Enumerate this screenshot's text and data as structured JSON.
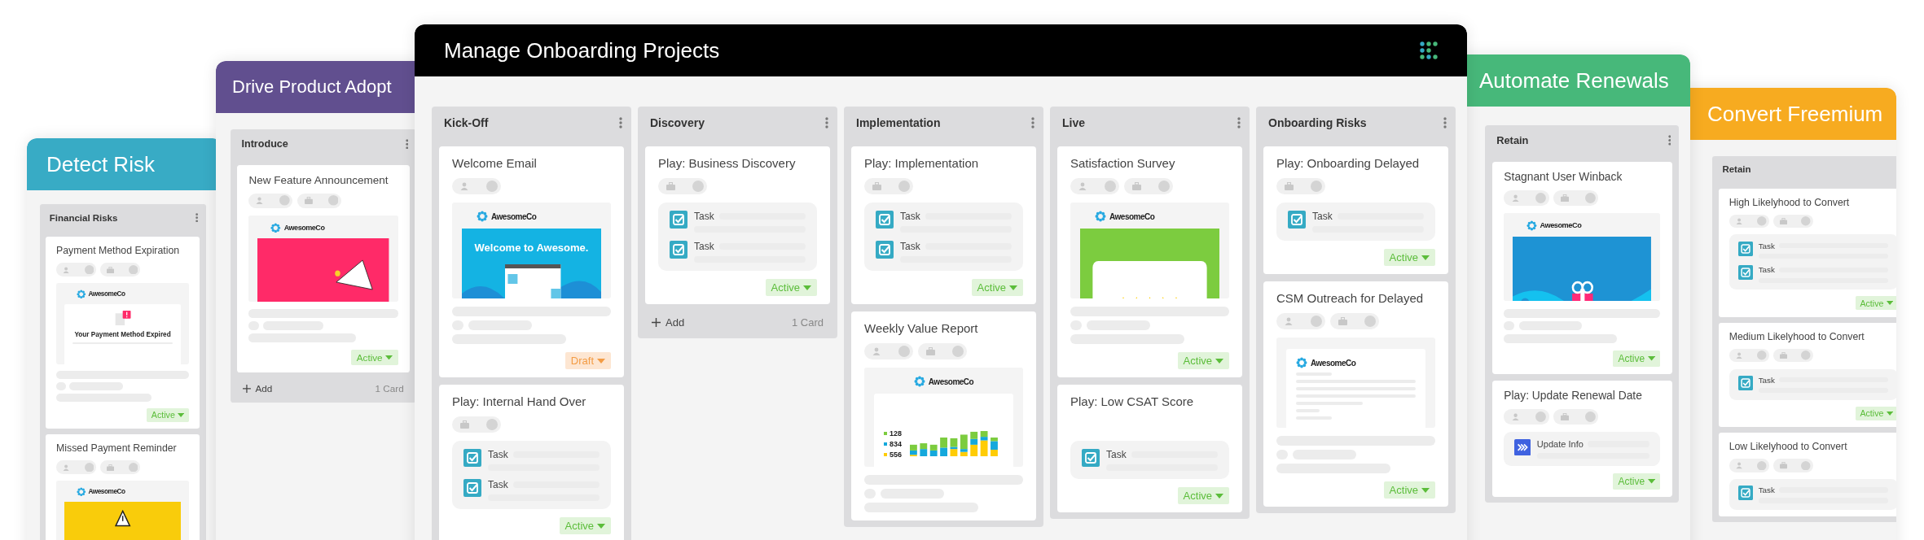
{
  "windows": [
    {
      "title": "Detect Risk",
      "color": "#38abc5",
      "columns": [
        {
          "title": "Financial Risks",
          "cards": [
            {
              "title": "Payment Method Expiration",
              "pills": [
                {
                  "kind": "person"
                },
                {
                  "kind": "briefcase"
                }
              ],
              "preview": {
                "kind": "expired",
                "logo": "AwesomeCo",
                "headline": "Your Payment Method Expired"
              },
              "placeholders": true,
              "status": {
                "label": "Active",
                "kind": "active"
              }
            },
            {
              "title": "Missed Payment Reminder",
              "pills": [
                {
                  "kind": "person"
                },
                {
                  "kind": "briefcase"
                }
              ],
              "preview": {
                "kind": "warning",
                "logo": "AwesomeCo"
              }
            }
          ]
        }
      ]
    },
    {
      "title": "Drive Product Adopt",
      "color": "#614f8f",
      "columns": [
        {
          "title": "Introduce",
          "cards": [
            {
              "title": "New Feature Announcement",
              "pills": [
                {
                  "kind": "person"
                },
                {
                  "kind": "briefcase"
                }
              ],
              "preview": {
                "kind": "megaphone",
                "logo": "AwesomeCo"
              },
              "placeholders": true,
              "status": {
                "label": "Active",
                "kind": "active"
              }
            }
          ],
          "footer": {
            "add": "Add",
            "count": "1 Card"
          }
        }
      ]
    },
    {
      "title": "Manage Onboarding Projects",
      "color": "#000000",
      "logo": true,
      "columns": [
        {
          "title": "Kick-Off",
          "cards": [
            {
              "title": "Welcome Email",
              "pills": [
                {
                  "kind": "person"
                }
              ],
              "preview": {
                "kind": "welcome",
                "logo": "AwesomeCo",
                "headline": "Welcome to Awesome."
              },
              "placeholders": true,
              "status": {
                "label": "Draft",
                "kind": "draft"
              }
            },
            {
              "title": "Play: Internal Hand Over",
              "pills": [
                {
                  "kind": "briefcase"
                }
              ],
              "tasks": [
                {
                  "label": "Task",
                  "kind": "task"
                },
                {
                  "label": "Task",
                  "kind": "task"
                }
              ],
              "status": {
                "label": "Active",
                "kind": "active"
              }
            }
          ]
        },
        {
          "title": "Discovery",
          "cards": [
            {
              "title": "Play: Business Discovery",
              "pills": [
                {
                  "kind": "briefcase"
                }
              ],
              "tasks": [
                {
                  "label": "Task",
                  "kind": "task"
                },
                {
                  "label": "Task",
                  "kind": "task"
                }
              ],
              "status": {
                "label": "Active",
                "kind": "active"
              }
            }
          ],
          "footer": {
            "add": "Add",
            "count": "1 Card"
          }
        },
        {
          "title": "Implementation",
          "cards": [
            {
              "title": "Play: Implementation",
              "pills": [
                {
                  "kind": "briefcase"
                }
              ],
              "tasks": [
                {
                  "label": "Task",
                  "kind": "task"
                },
                {
                  "label": "Task",
                  "kind": "task"
                }
              ],
              "status": {
                "label": "Active",
                "kind": "active"
              }
            },
            {
              "title": "Weekly Value Report",
              "pills": [
                {
                  "kind": "person"
                },
                {
                  "kind": "briefcase"
                }
              ],
              "preview": {
                "kind": "chart",
                "logo": "AwesomeCo",
                "legend": [
                  "128",
                  "834",
                  "556"
                ]
              },
              "placeholders": true
            }
          ]
        },
        {
          "title": "Live",
          "cards": [
            {
              "title": "Satisfaction Survey",
              "pills": [
                {
                  "kind": "person"
                },
                {
                  "kind": "briefcase"
                }
              ],
              "preview": {
                "kind": "stars",
                "logo": "AwesomeCo"
              },
              "placeholders": true,
              "status": {
                "label": "Active",
                "kind": "active"
              }
            },
            {
              "title": "Play: Low CSAT Score",
              "tasks": [
                {
                  "label": "Task",
                  "kind": "task"
                }
              ],
              "status": {
                "label": "Active",
                "kind": "active"
              }
            }
          ]
        },
        {
          "title": "Onboarding Risks",
          "cards": [
            {
              "title": "Play: Onboarding Delayed",
              "pills": [
                {
                  "kind": "briefcase"
                }
              ],
              "tasks": [
                {
                  "label": "Task",
                  "kind": "task"
                }
              ],
              "status": {
                "label": "Active",
                "kind": "active"
              }
            },
            {
              "title": "CSM Outreach for Delayed",
              "pills": [
                {
                  "kind": "person"
                },
                {
                  "kind": "briefcase"
                }
              ],
              "preview": {
                "kind": "letter",
                "logo": "AwesomeCo"
              },
              "placeholders": true,
              "status": {
                "label": "Active",
                "kind": "active"
              }
            }
          ]
        }
      ]
    },
    {
      "title": "Automate Renewals",
      "color": "#47b87a",
      "columns": [
        {
          "title": "Retain",
          "cards": [
            {
              "title": "Stagnant User Winback",
              "pills": [
                {
                  "kind": "person"
                },
                {
                  "kind": "briefcase"
                }
              ],
              "preview": {
                "kind": "gift",
                "logo": "AwesomeCo"
              },
              "placeholders": true,
              "status": {
                "label": "Active",
                "kind": "active"
              }
            },
            {
              "title": "Play: Update Renewal Date",
              "pills": [
                {
                  "kind": "person"
                },
                {
                  "kind": "briefcase"
                }
              ],
              "tasks": [
                {
                  "label": "Update Info",
                  "kind": "update"
                }
              ],
              "status": {
                "label": "Active",
                "kind": "active"
              }
            }
          ]
        }
      ]
    },
    {
      "title": "Convert Freemium",
      "color": "#f7ab20",
      "columns": [
        {
          "title": "Retain",
          "cards": [
            {
              "title": "High Likelyhood to Convert",
              "pills": [
                {
                  "kind": "person"
                },
                {
                  "kind": "briefcase"
                }
              ],
              "tasks": [
                {
                  "label": "Task",
                  "kind": "task"
                },
                {
                  "label": "Task",
                  "kind": "task"
                }
              ],
              "status": {
                "label": "Active",
                "kind": "active"
              }
            },
            {
              "title": "Medium Likelyhood to Convert",
              "pills": [
                {
                  "kind": "person"
                },
                {
                  "kind": "briefcase"
                }
              ],
              "tasks": [
                {
                  "label": "Task",
                  "kind": "task"
                }
              ],
              "status": {
                "label": "Active",
                "kind": "active"
              }
            },
            {
              "title": "Low Likelyhood to Convert",
              "pills": [
                {
                  "kind": "person"
                },
                {
                  "kind": "briefcase"
                }
              ],
              "tasks": [
                {
                  "label": "Task",
                  "kind": "task"
                }
              ]
            }
          ]
        }
      ]
    }
  ]
}
